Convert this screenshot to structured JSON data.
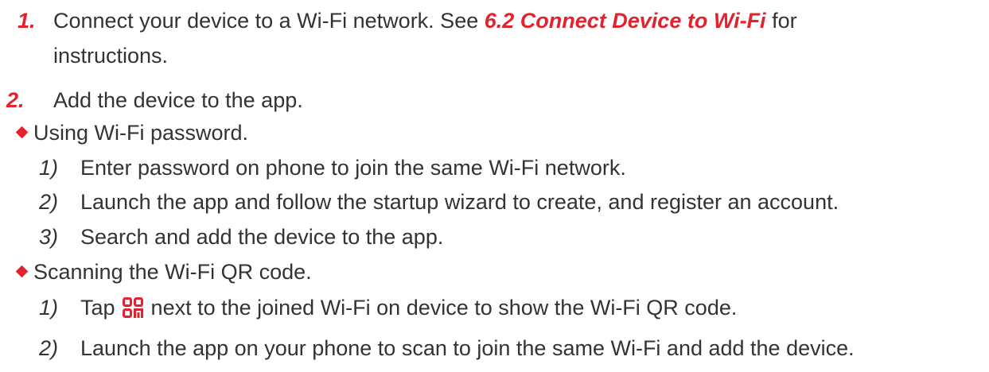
{
  "steps": [
    {
      "number": "1.",
      "text_before": "Connect your device to a Wi-Fi network. See ",
      "ref": "6.2 Connect Device to Wi-Fi",
      "text_after": " for",
      "continuation": "instructions."
    },
    {
      "number": "2.",
      "text": "Add the device to the app."
    }
  ],
  "methods": [
    {
      "title": "Using Wi-Fi password.",
      "substeps": [
        {
          "number": "1)",
          "text": "Enter password on phone to join the same Wi-Fi network."
        },
        {
          "number": "2)",
          "text": "Launch the app and follow the startup wizard to create, and register an account."
        },
        {
          "number": "3)",
          "text": "Search and add the device to the app."
        }
      ]
    },
    {
      "title": "Scanning the Wi-Fi QR code.",
      "substeps": [
        {
          "number": "1)",
          "text_before": "Tap ",
          "icon": "qr-code-icon",
          "text_after": " next to the joined Wi-Fi on device to show the Wi-Fi QR code."
        },
        {
          "number": "2)",
          "text": "Launch the app on your phone to scan to join the same Wi-Fi and add the device."
        }
      ]
    }
  ],
  "colors": {
    "accent": "#e3222e",
    "text": "#333333"
  }
}
